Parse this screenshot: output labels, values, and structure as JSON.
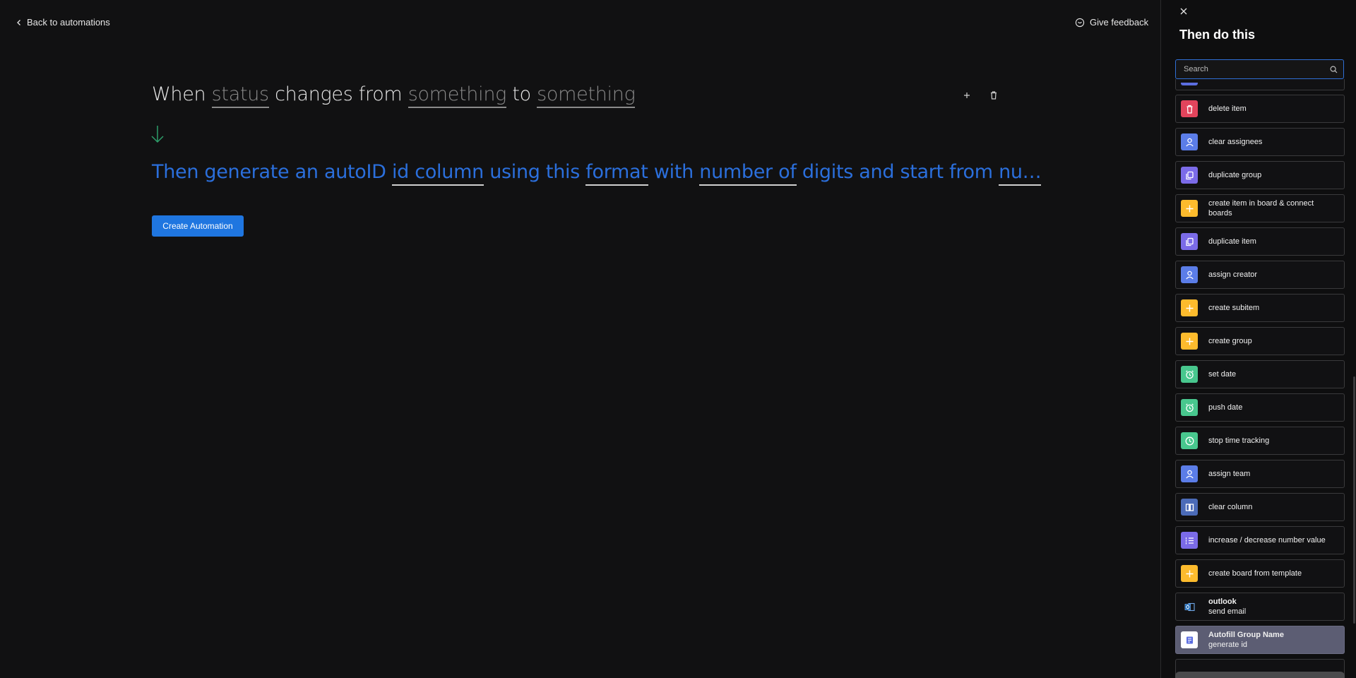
{
  "nav": {
    "back_label": "Back to automations",
    "feedback_label": "Give feedback"
  },
  "recipe": {
    "when": {
      "w1": "When",
      "s1": "status",
      "w2": "changes from",
      "s2": "something",
      "w3": "to",
      "s3": "something"
    },
    "then": {
      "w1": "Then generate an autoID",
      "s1": "id column",
      "w2": "using this",
      "s2": "format",
      "w3": "with",
      "s3": "number of",
      "w4": "digits and start from",
      "s4": "nu…"
    }
  },
  "create_button": "Create Automation",
  "panel": {
    "title": "Then do this",
    "search_placeholder": "Search",
    "items": [
      {
        "label": "delete item",
        "icon": "trash-icon",
        "color": "#e2445c"
      },
      {
        "label": "clear assignees",
        "icon": "person-icon",
        "color": "#5b7de8"
      },
      {
        "label": "duplicate group",
        "icon": "copy-icon",
        "color": "#7b6be8"
      },
      {
        "label": "create item in board & connect boards",
        "icon": "plus-icon",
        "color": "#fdbb2d"
      },
      {
        "label": "duplicate item",
        "icon": "copy-icon",
        "color": "#7b6be8"
      },
      {
        "label": "assign creator",
        "icon": "person-icon",
        "color": "#5b7de8"
      },
      {
        "label": "create subitem",
        "icon": "plus-icon",
        "color": "#fdbb2d"
      },
      {
        "label": "create group",
        "icon": "plus-icon",
        "color": "#fdbb2d"
      },
      {
        "label": "set date",
        "icon": "alarm-icon",
        "color": "#48c78e"
      },
      {
        "label": "push date",
        "icon": "alarm-icon",
        "color": "#48c78e"
      },
      {
        "label": "stop time tracking",
        "icon": "clock-icon",
        "color": "#48c78e"
      },
      {
        "label": "assign team",
        "icon": "person-icon",
        "color": "#5b7de8"
      },
      {
        "label": "clear column",
        "icon": "column-icon",
        "color": "#4b6bb8"
      },
      {
        "label": "increase / decrease number value",
        "icon": "number-list-icon",
        "color": "#7b6be8"
      },
      {
        "label": "create board from template",
        "icon": "plus-icon",
        "color": "#fdbb2d"
      },
      {
        "label": "outlook",
        "sublabel": "send email",
        "icon": "outlook-icon",
        "color": "#0f5fb0"
      },
      {
        "label": "Autofill Group Name",
        "sublabel": "generate id",
        "icon": "app-icon",
        "color": "#ffffff"
      }
    ]
  }
}
